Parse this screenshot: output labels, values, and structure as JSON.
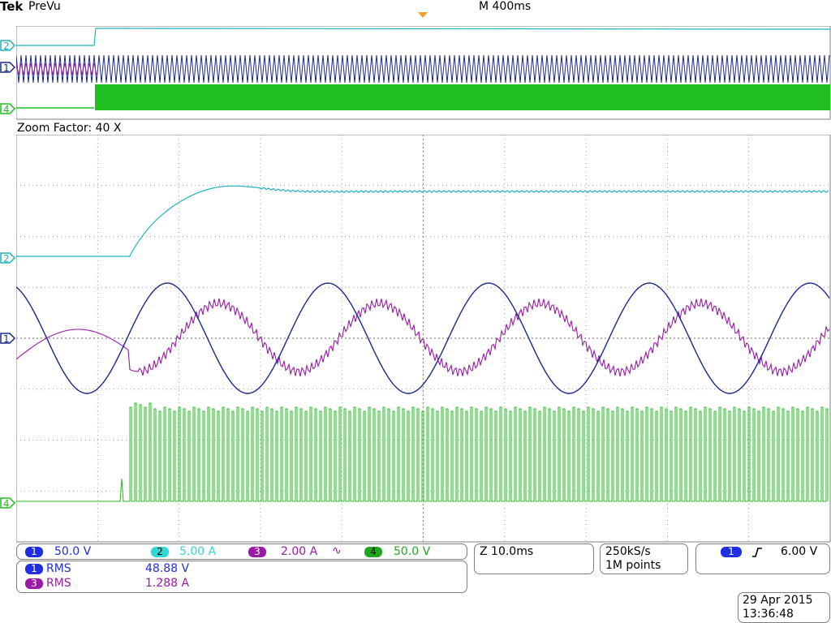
{
  "header": {
    "brand": "Tek",
    "mode": "PreVu",
    "timebase": "M 400ms"
  },
  "zoom": {
    "label": "Zoom Factor: 40 X"
  },
  "channel_markers": {
    "ch1": "1",
    "ch2": "2",
    "ch3": "3",
    "ch4": "4"
  },
  "readouts": {
    "channels": [
      {
        "num": "1",
        "value": "50.0 V",
        "color": "#1e2ee0"
      },
      {
        "num": "2",
        "value": "5.00 A",
        "color": "#33d6d6"
      },
      {
        "num": "3",
        "value": "2.00 A",
        "suffix": "∿",
        "color": "#9a1aa8"
      },
      {
        "num": "4",
        "value": "50.0 V",
        "color": "#1fa81f"
      }
    ],
    "measurements": [
      {
        "num": "1",
        "label": "RMS",
        "value": "48.88 V",
        "color": "#1e2ee0"
      },
      {
        "num": "3",
        "label": "RMS",
        "value": "1.288 A",
        "color": "#9a1aa8"
      }
    ],
    "horizontal": {
      "scale": "Z 10.0ms"
    },
    "acquisition": {
      "rate": "250kS/s",
      "points": "1M points"
    },
    "trigger": {
      "num": "1",
      "slope": "rising",
      "level": "6.00 V",
      "color": "#1e2ee0"
    },
    "datetime": {
      "date": "29 Apr  2015",
      "time": "13:36:48"
    }
  },
  "colors": {
    "ch1": "#1a2a8c",
    "ch2": "#1fb2c0",
    "ch3": "#9a1aa8",
    "ch4": "#1fbf1f",
    "grid": "#8a8a8a"
  }
}
